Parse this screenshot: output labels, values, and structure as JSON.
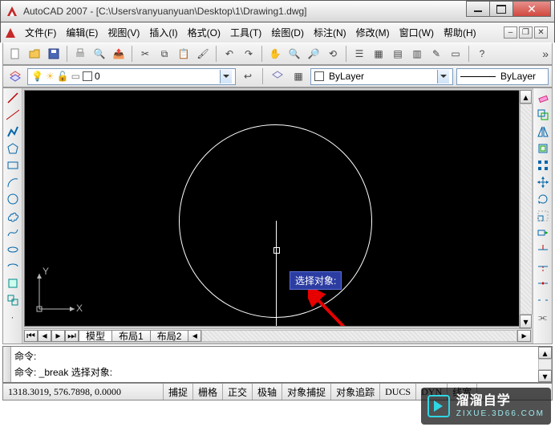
{
  "window": {
    "title": "AutoCAD 2007 - [C:\\Users\\ranyuanyuan\\Desktop\\1\\Drawing1.dwg]"
  },
  "menu": {
    "file": "文件(F)",
    "edit": "编辑(E)",
    "view": "视图(V)",
    "insert": "插入(I)",
    "format": "格式(O)",
    "tools": "工具(T)",
    "draw": "绘图(D)",
    "dimension": "标注(N)",
    "modify": "修改(M)",
    "window": "窗口(W)",
    "help": "帮助(H)"
  },
  "layer": {
    "current": "0",
    "color_label": "ByLayer",
    "linetype_label": "ByLayer"
  },
  "canvas": {
    "tooltip": "选择对象:",
    "ucs_x": "X",
    "ucs_y": "Y"
  },
  "tabs": {
    "model": "模型",
    "layout1": "布局1",
    "layout2": "布局2"
  },
  "command": {
    "line1": "命令:",
    "line2": "命令: _break 选择对象:"
  },
  "status": {
    "coords": "1318.3019, 576.7898, 0.0000",
    "snap": "捕捉",
    "grid": "栅格",
    "ortho": "正交",
    "polar": "极轴",
    "osnap": "对象捕捉",
    "otrack": "对象追踪",
    "ducs": "DUCS",
    "dyn": "DYN",
    "lwt": "线宽",
    "extra": "..."
  },
  "watermark": {
    "cn": "溜溜自学",
    "url": "ZIXUE.3D66.COM"
  },
  "icons": {
    "line": "line",
    "xline": "xline",
    "pline": "pline",
    "polygon": "polygon",
    "rect": "rect",
    "arc": "arc",
    "circle": "circle",
    "revcloud": "revcloud",
    "spline": "spline",
    "ellipse": "ellipse",
    "ellipsearc": "ellipsearc",
    "insert": "insert",
    "block": "block",
    "point": "point",
    "hatch": "hatch",
    "gradient": "gradient",
    "region": "region",
    "table": "table",
    "mtext": "mtext",
    "erase": "erase",
    "copy": "copy",
    "mirror": "mirror",
    "offset": "offset",
    "array": "array",
    "move": "move",
    "rotate": "rotate",
    "scale": "scale",
    "stretch": "stretch",
    "trim": "trim",
    "extend": "extend",
    "break1": "break1",
    "break2": "break2",
    "chamfer": "chamfer",
    "fillet": "fillet",
    "explode": "explode"
  }
}
